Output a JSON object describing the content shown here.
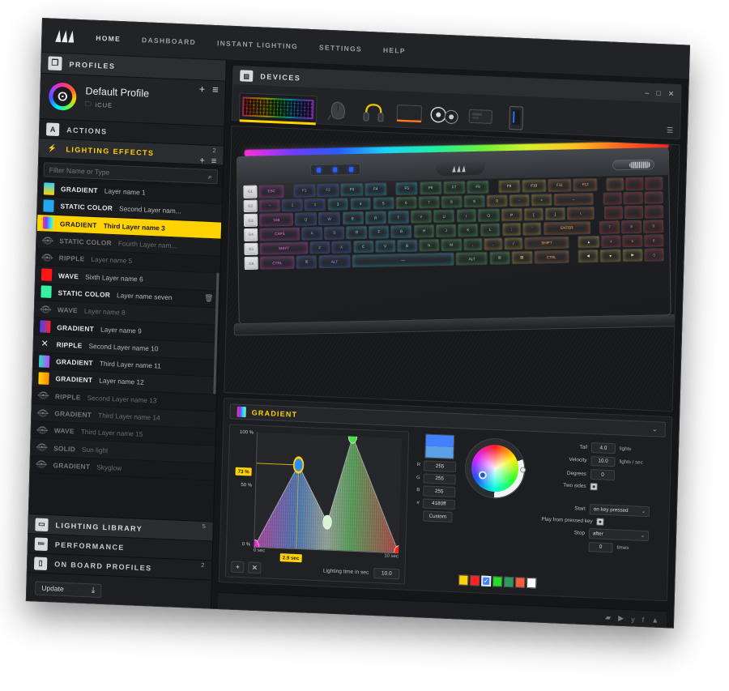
{
  "app": {
    "brand": "CORSAIR",
    "window_controls": [
      "–",
      "□",
      "✕"
    ]
  },
  "menu": [
    {
      "label": "HOME"
    },
    {
      "label": "DASHBOARD"
    },
    {
      "label": "INSTANT LIGHTING"
    },
    {
      "label": "SETTINGS"
    },
    {
      "label": "HELP"
    }
  ],
  "profiles": {
    "title": "PROFILES",
    "icon": "copy-icon",
    "add_label": "+",
    "menu_label": "≡",
    "current": {
      "name": "Default Profile",
      "folder": "iCUE",
      "folder_icon": "folder-icon"
    }
  },
  "sidebar": {
    "actions": {
      "label": "ACTIONS",
      "glyph": "A",
      "count": ""
    },
    "lighting_effects": {
      "label": "LIGHTING EFFECTS",
      "glyph": "⚡",
      "count": "2",
      "add_label": "+",
      "menu_label": "≡"
    },
    "filter": {
      "placeholder": "Filter Name or Type",
      "value": "",
      "icon": "search-icon"
    },
    "bottom": [
      {
        "label": "LIGHTING LIBRARY",
        "glyph": "▭",
        "count": "5",
        "active": true
      },
      {
        "label": "PERFORMANCE",
        "glyph": "≔",
        "count": "",
        "active": false
      },
      {
        "label": "ON BOARD PROFILES",
        "glyph": "▯",
        "count": "2",
        "active": false
      }
    ],
    "update": {
      "label": "Update",
      "icon": "download-icon"
    }
  },
  "layers": [
    {
      "type": "GRADIENT",
      "name": "Layer name 1",
      "chip": "linear-gradient(180deg,#2ad1ff,#ffd200)",
      "visible": true,
      "selected": false
    },
    {
      "type": "STATIC COLOR",
      "name": "Second Layer nam...",
      "chip": "#22a7f0",
      "visible": true,
      "selected": false
    },
    {
      "type": "GRADIENT",
      "name": "Third Layer name 3",
      "chip": "linear-gradient(90deg,#ff2d9b,#7a3cff,#2ad1ff,#8cf0a0)",
      "visible": true,
      "selected": true
    },
    {
      "type": "STATIC COLOR",
      "name": "Fourth Layer nam...",
      "chip": "",
      "visible": false,
      "selected": false
    },
    {
      "type": "RIPPLE",
      "name": "Layer name 5",
      "chip": "",
      "visible": false,
      "selected": false
    },
    {
      "type": "WAVE",
      "name": "Sixth Layer name 6",
      "chip": "#ff1414",
      "visible": true,
      "selected": false
    },
    {
      "type": "STATIC COLOR",
      "name": "Layer name seven",
      "chip": "#36f0a0",
      "visible": true,
      "selected": false,
      "trash": "🗑"
    },
    {
      "type": "WAVE",
      "name": "Layer name 8",
      "chip": "",
      "visible": false,
      "selected": false
    },
    {
      "type": "GRADIENT",
      "name": "Layer name 9",
      "chip": "linear-gradient(90deg,#3c46ff,#ff2020)",
      "visible": true,
      "selected": false
    },
    {
      "type": "RIPPLE",
      "name": "Second Layer name 10",
      "chip": "",
      "visible": true,
      "selected": false,
      "shuffle": true
    },
    {
      "type": "GRADIENT",
      "name": "Third Layer name 11",
      "chip": "linear-gradient(90deg,#20e0c0,#c040ff)",
      "visible": true,
      "selected": false
    },
    {
      "type": "GRADIENT",
      "name": "Layer name 12",
      "chip": "linear-gradient(90deg,#ffd200,#ff8c00)",
      "visible": true,
      "selected": false
    },
    {
      "type": "RIPPLE",
      "name": "Second Layer name 13",
      "chip": "",
      "visible": false,
      "selected": false
    },
    {
      "type": "GRADIENT",
      "name": "Third Layer name 14",
      "chip": "",
      "visible": false,
      "selected": false
    },
    {
      "type": "WAVE",
      "name": "Third Layer name 15",
      "chip": "",
      "visible": false,
      "selected": false
    },
    {
      "type": "SOLID",
      "name": "Sun light",
      "chip": "",
      "visible": false,
      "selected": false
    },
    {
      "type": "GRADIENT",
      "name": "Skyglow",
      "chip": "",
      "visible": false,
      "selected": false
    }
  ],
  "devices": {
    "title": "DEVICES",
    "icon": "device-icon",
    "menu_icon": "list-icon",
    "items": [
      {
        "name": "keyboard",
        "selected": true
      },
      {
        "name": "mouse",
        "selected": false
      },
      {
        "name": "headset",
        "selected": false
      },
      {
        "name": "mousepad",
        "selected": false
      },
      {
        "name": "cooler",
        "selected": false
      },
      {
        "name": "controller",
        "selected": false
      },
      {
        "name": "pc-case",
        "selected": false
      }
    ]
  },
  "editor": {
    "effect_name": "GRADIENT",
    "caret": "⌄",
    "lighting_time": {
      "label": "Lighting time in sec",
      "value": "10.0"
    },
    "add_point": "+",
    "remove_point": "✕",
    "color": {
      "r_label": "R",
      "r_value": "255",
      "g_label": "G",
      "g_value": "255",
      "b_label": "B",
      "b_value": "255",
      "hex_label": "#",
      "hex_value": "4180ff",
      "custom_label": "Custom",
      "swatches": [
        "#ffd200",
        "#ff2020",
        "#4180ff",
        "#22e022",
        "#2d9a5e",
        "#ff5a3c",
        "#ffffff"
      ],
      "selected_swatch_index": 2
    },
    "params": {
      "tail": {
        "label": "Tail",
        "value": "4.0",
        "unit": "lights"
      },
      "velocity": {
        "label": "Velocity",
        "value": "10.0",
        "unit": "lights / sec"
      },
      "degrees": {
        "label": "Degrees",
        "value": "0",
        "unit": ""
      },
      "two_sides": {
        "label": "Two sides",
        "checked": false
      },
      "start": {
        "label": "Start",
        "value": "on key pressed"
      },
      "play_from_pressed_key": {
        "label": "Play from pressed key",
        "checked": false
      },
      "stop": {
        "label": "Stop",
        "value": "after"
      },
      "times": {
        "value": "0",
        "unit": "times"
      }
    }
  },
  "chart_data": {
    "type": "line",
    "title": "GRADIENT",
    "xlabel": "Lighting time in sec",
    "ylabel": "",
    "xlim": [
      0,
      10
    ],
    "ylim": [
      0,
      100
    ],
    "x_ticks": [
      "0 sec",
      "10 sec"
    ],
    "y_ticks": [
      "0 %",
      "50 %",
      "100 %"
    ],
    "annotations": {
      "y_badge": "73 %",
      "x_badge": "2.9 sec"
    },
    "points": [
      {
        "x": 0.0,
        "y": 0,
        "color": "#ff22d8",
        "label": "0 sec"
      },
      {
        "x": 2.9,
        "y": 73,
        "color": "#ffd200",
        "label": "2.9 sec",
        "selected": true
      },
      {
        "x": 5.0,
        "y": 24,
        "color": "#d7f5d0",
        "label": ""
      },
      {
        "x": 6.6,
        "y": 100,
        "color": "#49e04a",
        "label": ""
      },
      {
        "x": 10.0,
        "y": 0,
        "color": "#ff2020",
        "label": "10 sec"
      }
    ]
  }
}
